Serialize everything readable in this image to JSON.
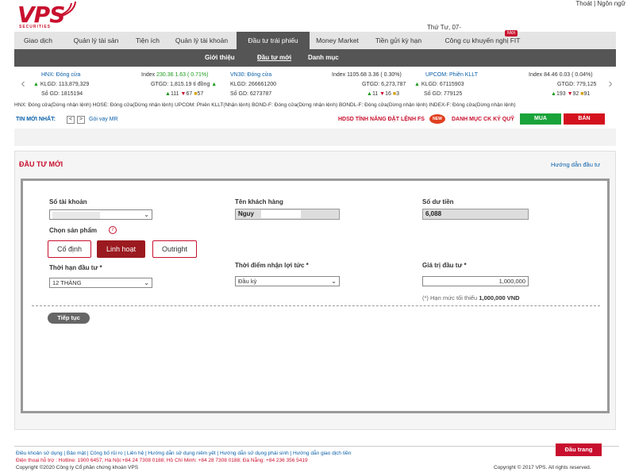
{
  "brand": {
    "name": "VPS",
    "sub": "SECURITIES",
    "color": "#c8102e"
  },
  "topbar": {
    "user_links": "Thoát | Ngôn ngữ",
    "date": "Thứ Tư, 07-"
  },
  "mainnav": {
    "items": [
      "Giao dịch",
      "Quản lý tài sản",
      "Tiện ích",
      "Quản lý tài khoản",
      "Đầu tư trái phiếu",
      "Money Market",
      "Tiền gửi kỳ hạn",
      "Công cụ khuyến nghị FIT"
    ],
    "active_index": 4,
    "badge": "Mới"
  },
  "subnav": {
    "items": [
      "Giới thiệu",
      "Đầu tư mới",
      "Danh mục"
    ],
    "active_index": 1
  },
  "ticker": {
    "hnx": {
      "title": "HNX: Đóng cửa",
      "index_label": "Index",
      "index": "230.36",
      "change": "1.63 ( 0.71%)",
      "klgd_label": "KLGD:",
      "klgd": "113,879,329",
      "gtgd_label": "GTGD:",
      "gtgd": "1,815.19 tỉ đồng",
      "sogd_label": "Số GD:",
      "sogd": "1815194",
      "up": "111",
      "down": "67",
      "eq": "57"
    },
    "vn30": {
      "title": "VN30: Đóng cửa",
      "klgd_label": "KLGD:",
      "klgd": "266661200",
      "sogd_label": "Số GD:",
      "sogd": "6273787"
    },
    "mid": {
      "index_label": "Index",
      "index": "1105.68",
      "change": "3.36 ( 0.30%)",
      "gtgd_label": "GTGD:",
      "gtgd": "6,273,787",
      "up": "11",
      "down": "16",
      "eq": "3"
    },
    "upcom": {
      "title": "UPCOM: Phiên KLLT",
      "klgd_label": "KLGD:",
      "klgd": "67115903",
      "sogd_label": "Số GD:",
      "sogd": "779125",
      "index_label": "Index",
      "index": "84.46",
      "change": "0.03 ( 0.04%)",
      "gtgd_label": "GTGD:",
      "gtgd": "779,125",
      "up": "193",
      "down": "92",
      "eq": "91"
    }
  },
  "status_line": "HNX: Đóng cửa(Dừng nhận lệnh)  HOSE: Đóng cửa(Dừng nhận lệnh)  UPCOM: Phiên KLLT(Nhận lệnh)  BOND-F: Đóng cửa(Dừng nhận lệnh)  BONDL-F: Đóng cửa(Dừng nhận lệnh)  INDEX-F: Đóng cửa(Dừng nhận lệnh)",
  "news": {
    "label": "TIN MỚI NHẤT:",
    "prev": "<",
    "next": ">",
    "item": "Gói vay MR"
  },
  "promo": {
    "hdsd": "HDSD TÍNH NĂNG ĐẶT LỆNH FS",
    "new_badge": "NEW",
    "dm": "DANH MỤC CK KÝ QUỸ",
    "buy": "MUA",
    "sell": "BÁN"
  },
  "panel": {
    "title": "ĐẦU TƯ MỚI",
    "guide": "Hướng dẫn đầu tư"
  },
  "form": {
    "account_label": "Số tài khoản",
    "account_value": "",
    "customer_label": "Tên khách hàng",
    "customer_value": "Nguy",
    "balance_label": "Số dư tiền",
    "balance_value": "6,088",
    "product_label": "Chọn sản phẩm",
    "products": [
      "Cố định",
      "Linh hoạt",
      "Outright"
    ],
    "product_active": 1,
    "term_label": "Thời hạn đầu tư *",
    "term_value": "12 THÁNG",
    "payout_label": "Thời điểm nhận lợi tức *",
    "payout_value": "Đầu kỳ",
    "amount_label": "Giá trị đầu tư *",
    "amount_value": "1,000,000",
    "min_note_prefix": "(*) Hạn mức tối thiểu",
    "min_note_value": "1,000,000 VND",
    "continue": "Tiếp tục"
  },
  "footer": {
    "links": "Điều khoản sử dụng  |  Bảo mật  |  Công bố rủi ro  |  Liên hệ  |  Hướng dẫn sử dụng niêm yết  |  Hướng dẫn sử dụng phái sinh  |  Hướng dẫn giao dịch tiền",
    "hotline": "Điện thoại hỗ trợ : Hotline: 1900 6457; Hà Nội:+84 24 7308 0188; Hồ Chí Minh: +84 28 7308 0188; Đà Nẵng: +84 236 356 5419",
    "copyright_left": "Copyright ©2020 Công ty Cổ phần chứng khoán VPS",
    "copyright_right": "Copyright © 2017 VPS. All rights reserved.",
    "top_button": "Đầu trang"
  }
}
